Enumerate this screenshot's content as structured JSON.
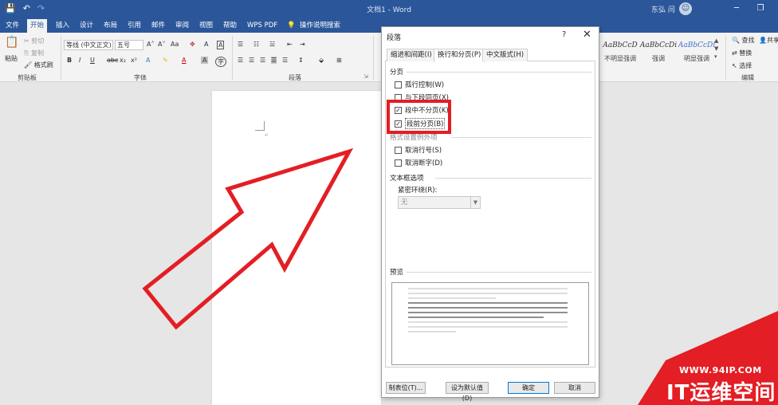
{
  "title_bar": {
    "doc_title": "文档1 - Word",
    "user_name": "东弘 闫",
    "avatar_glyph": "☺",
    "save_icon": "💾",
    "undo_icon": "↶",
    "redo_icon": "↷",
    "minimize_icon": "─",
    "restore_icon": "❐"
  },
  "tabs": [
    "文件",
    "开始",
    "插入",
    "设计",
    "布局",
    "引用",
    "邮件",
    "审阅",
    "视图",
    "帮助",
    "WPS PDF"
  ],
  "active_tab": "开始",
  "search": {
    "icon": "💡",
    "label": "操作说明搜索"
  },
  "ribbon": {
    "clipboard": {
      "paste": "粘贴",
      "cut": "剪切",
      "copy": "复制",
      "format_painter": "格式刷",
      "group": "剪贴板"
    },
    "font": {
      "font_name": "等线 (中文正文)",
      "font_size": "五号",
      "group": "字体",
      "bold": "B",
      "italic": "I",
      "underline": "U",
      "strike": "abc",
      "sub": "x₂",
      "sup": "x²",
      "grow": "A˄",
      "shrink": "A˅",
      "case": "Aa",
      "clear": "✥",
      "border": "A",
      "effect": "A",
      "highlight": "✎",
      "color": "A",
      "shade": "A"
    },
    "paragraph": {
      "group": "段落"
    },
    "styles": [
      {
        "sample": "AaBbCcD",
        "name": "不明显强调"
      },
      {
        "sample": "AaBbCcDi",
        "name": "强调"
      },
      {
        "sample": "AaBbCcDi",
        "name": "明显强调"
      }
    ],
    "editing": {
      "find": "查找",
      "replace": "替换",
      "select": "选择",
      "group": "编辑",
      "share": "共享"
    }
  },
  "dialog": {
    "title": "段落",
    "help": "?",
    "close": "✕",
    "tabs": [
      "缩进和间距(I)",
      "换行和分页(P)",
      "中文版式(H)"
    ],
    "active_tab": "换行和分页(P)",
    "pagination": {
      "title": "分页",
      "options": [
        {
          "label": "孤行控制(W)",
          "checked": false
        },
        {
          "label": "与下段同页(X)",
          "checked": false
        },
        {
          "label": "段中不分页(K)",
          "checked": true
        },
        {
          "label": "段前分页(B)",
          "checked": true
        }
      ]
    },
    "format_exceptions": {
      "title": "格式设置例外项",
      "options": [
        {
          "label": "取消行号(S)",
          "checked": false
        },
        {
          "label": "取消断字(D)",
          "checked": false
        }
      ]
    },
    "textbox": {
      "title": "文本框选项",
      "wrap_label": "紧密环绕(R):",
      "wrap_value": "无"
    },
    "preview": {
      "title": "预览"
    },
    "buttons": {
      "tabs": "制表位(T)...",
      "set_default": "设为默认值(D)",
      "ok": "确定",
      "cancel": "取消"
    }
  },
  "watermark": {
    "url": "WWW.94IP.COM",
    "brand": "IT运维空间"
  }
}
